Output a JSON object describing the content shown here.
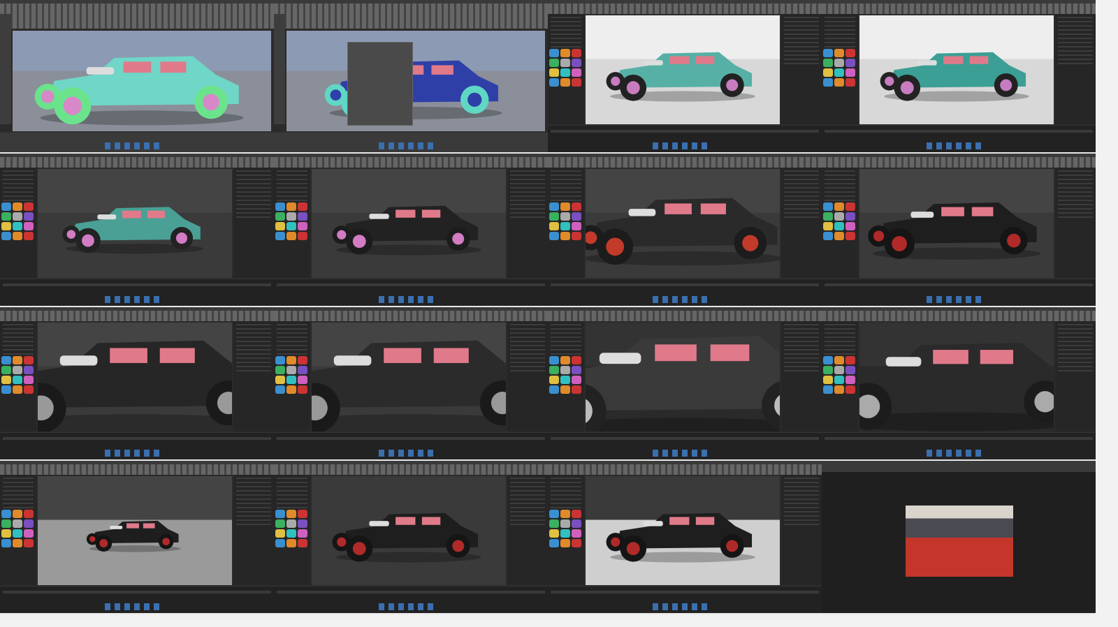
{
  "layout": "video-thumbnail-contact-sheet",
  "thumbnails": [
    {
      "app": "maya",
      "bg": "#8a8f99",
      "sky": "#8c9bb3",
      "body": "#6fd6c8",
      "wheel": "#6be38c",
      "rim": "#d887c9",
      "scale": 1.0
    },
    {
      "app": "maya",
      "bg": "#8a8f99",
      "sky": "#8c9bb3",
      "body": "#2f3fa8",
      "wheel": "#5fd7c4",
      "rim": "#2f3fa8",
      "scale": 0.85,
      "dialog": true
    },
    {
      "app": "keyshot",
      "bg": "#d8d8d8",
      "sky": "#eeeeee",
      "body": "#56b0a5",
      "wheel": "#222",
      "rim": "#c77cc0",
      "scale": 0.95
    },
    {
      "app": "keyshot",
      "bg": "#d8d8d8",
      "sky": "#eeeeee",
      "body": "#3b9f95",
      "wheel": "#222",
      "rim": "#c77cc0",
      "scale": 0.95
    },
    {
      "app": "keyshot",
      "bg": "#3a3a3a",
      "sky": "#444",
      "body": "#4aa095",
      "wheel": "#222",
      "rim": "#d27cc4",
      "scale": 0.9
    },
    {
      "app": "keyshot",
      "bg": "#3a3a3a",
      "sky": "#444",
      "body": "#222",
      "wheel": "#1c1c1c",
      "rim": "#d27cc4",
      "scale": 0.95
    },
    {
      "app": "keyshot",
      "bg": "#3a3a3a",
      "sky": "#444",
      "body": "#2a2a2a",
      "wheel": "#1c1c1c",
      "rim": "#c23a2a",
      "scale": 1.3
    },
    {
      "app": "keyshot",
      "bg": "#3a3a3a",
      "sky": "#444",
      "body": "#1e1e1e",
      "wheel": "#151515",
      "rim": "#b02a2a",
      "scale": 1.1
    },
    {
      "app": "keyshot",
      "bg": "#3a3a3a",
      "sky": "#444",
      "body": "#262626",
      "wheel": "#1a1a1a",
      "rim": "#999",
      "scale": 1.8
    },
    {
      "app": "keyshot",
      "bg": "#3a3a3a",
      "sky": "#444",
      "body": "#2b2b2b",
      "wheel": "#1a1a1a",
      "rim": "#999",
      "scale": 1.8
    },
    {
      "app": "keyshot",
      "bg": "#2a2a2a",
      "sky": "#333",
      "body": "#3a3a3a",
      "wheel": "#222",
      "rim": "#bbb",
      "scale": 2.0
    },
    {
      "app": "keyshot",
      "bg": "#2a2a2a",
      "sky": "#333",
      "body": "#2a2a2a",
      "wheel": "#1c1c1c",
      "rim": "#aaa",
      "scale": 1.7
    },
    {
      "app": "keyshot",
      "bg": "#9a9a9a",
      "sky": "#444",
      "body": "#1e1e1e",
      "wheel": "#151515",
      "rim": "#b02a2a",
      "scale": 0.6
    },
    {
      "app": "keyshot",
      "bg": "#3a3a3a",
      "sky": "#3a3a3a",
      "body": "#1e1e1e",
      "wheel": "#151515",
      "rim": "#b02a2a",
      "scale": 0.95
    },
    {
      "app": "keyshot",
      "bg": "#cfcfcf",
      "sky": "#3a3a3a",
      "body": "#1e1e1e",
      "wheel": "#151515",
      "rim": "#b02a2a",
      "scale": 0.95
    },
    {
      "app": "viewer",
      "bg": "#1f1f1f"
    }
  ],
  "swatch_colors": [
    "#3a8fd0",
    "#e08a2a",
    "#c33",
    "#3ab060",
    "#aaa",
    "#7a4fc0",
    "#e0c040",
    "#30c0c0",
    "#d060c0"
  ]
}
